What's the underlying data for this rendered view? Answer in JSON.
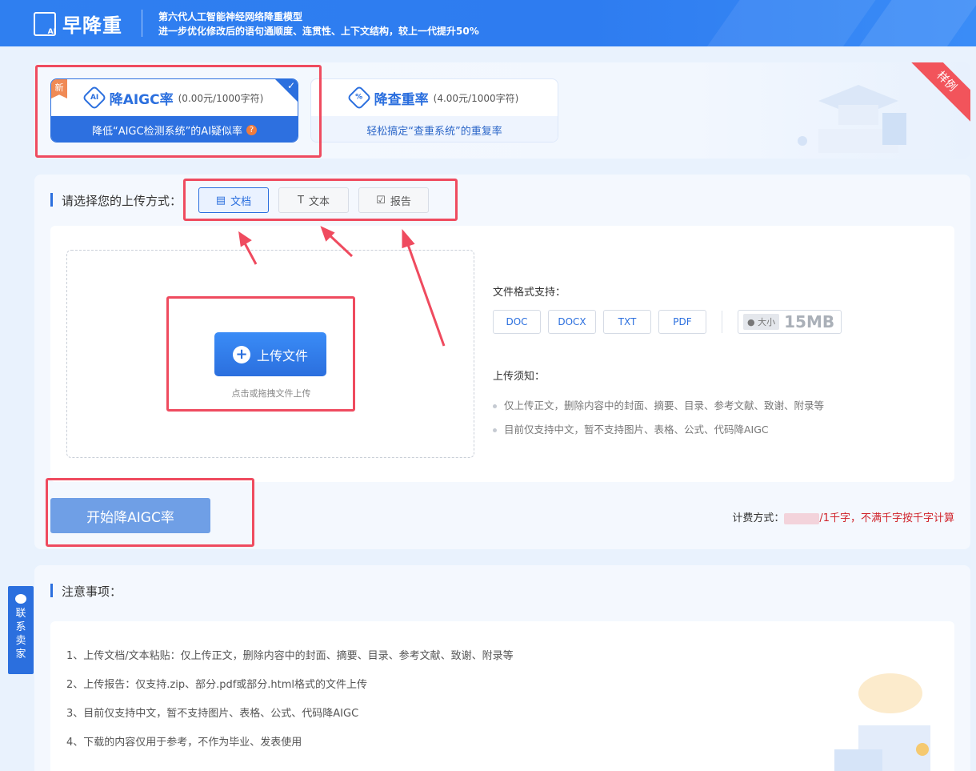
{
  "header": {
    "logo_text": "早降重",
    "logo_badge": "AI",
    "slogan_line1": "第六代人工智能神经网络降重模型",
    "slogan_line2": "进一步优化修改后的语句通顺度、连贯性、上下文结构，较上一代提升50%"
  },
  "modes": {
    "sample_ribbon": "样例",
    "aigc": {
      "new_tag": "新",
      "icon_text": "AI",
      "title": "降AIGC率",
      "price": "(0.00元/1000字符)",
      "desc": "降低“AIGC检测系统”的AI疑似率",
      "help": "?"
    },
    "duplicate": {
      "icon_text": "%",
      "title": "降查重率",
      "price": "(4.00元/1000字符)",
      "desc": "轻松搞定“查重系统”的重复率"
    }
  },
  "upload": {
    "section_title": "请选择您的上传方式：",
    "tabs": [
      {
        "label": "文档",
        "icon": "document-icon"
      },
      {
        "label": "文本",
        "icon": "text-icon"
      },
      {
        "label": "报告",
        "icon": "report-icon"
      }
    ],
    "active_tab": "文档",
    "upload_button": "上传文件",
    "upload_hint": "点击或拖拽文件上传",
    "formats_label": "文件格式支持：",
    "formats": [
      "DOC",
      "DOCX",
      "TXT",
      "PDF"
    ],
    "size_label": "大小",
    "size_value": "15MB",
    "notice_label": "上传须知：",
    "notices": [
      "仅上传正文，删除内容中的封面、摘要、目录、参考文献、致谢、附录等",
      "目前仅支持中文，暂不支持图片、表格、公式、代码降AIGC"
    ],
    "start_button": "开始降AIGC率",
    "billing_label": "计费方式：",
    "billing_unit": "/1千字，",
    "billing_note": "不满千字按千字计算"
  },
  "notes": {
    "section_title": "注意事项：",
    "items": [
      "1、上传文档/文本粘贴：仅上传正文，删除内容中的封面、摘要、目录、参考文献、致谢、附录等",
      "2、上传报告：仅支持.zip、部分.pdf或部分.html格式的文件上传",
      "3、目前仅支持中文，暂不支持图片、表格、公式、代码降AIGC",
      "4、下载的内容仅用于参考，不作为毕业、发表使用"
    ]
  },
  "contact": {
    "label_chars": [
      "联",
      "系",
      "卖",
      "家"
    ]
  },
  "colors": {
    "primary": "#2b6fde",
    "annotation": "#ef4b5f",
    "billing_red": "#d0232b"
  }
}
